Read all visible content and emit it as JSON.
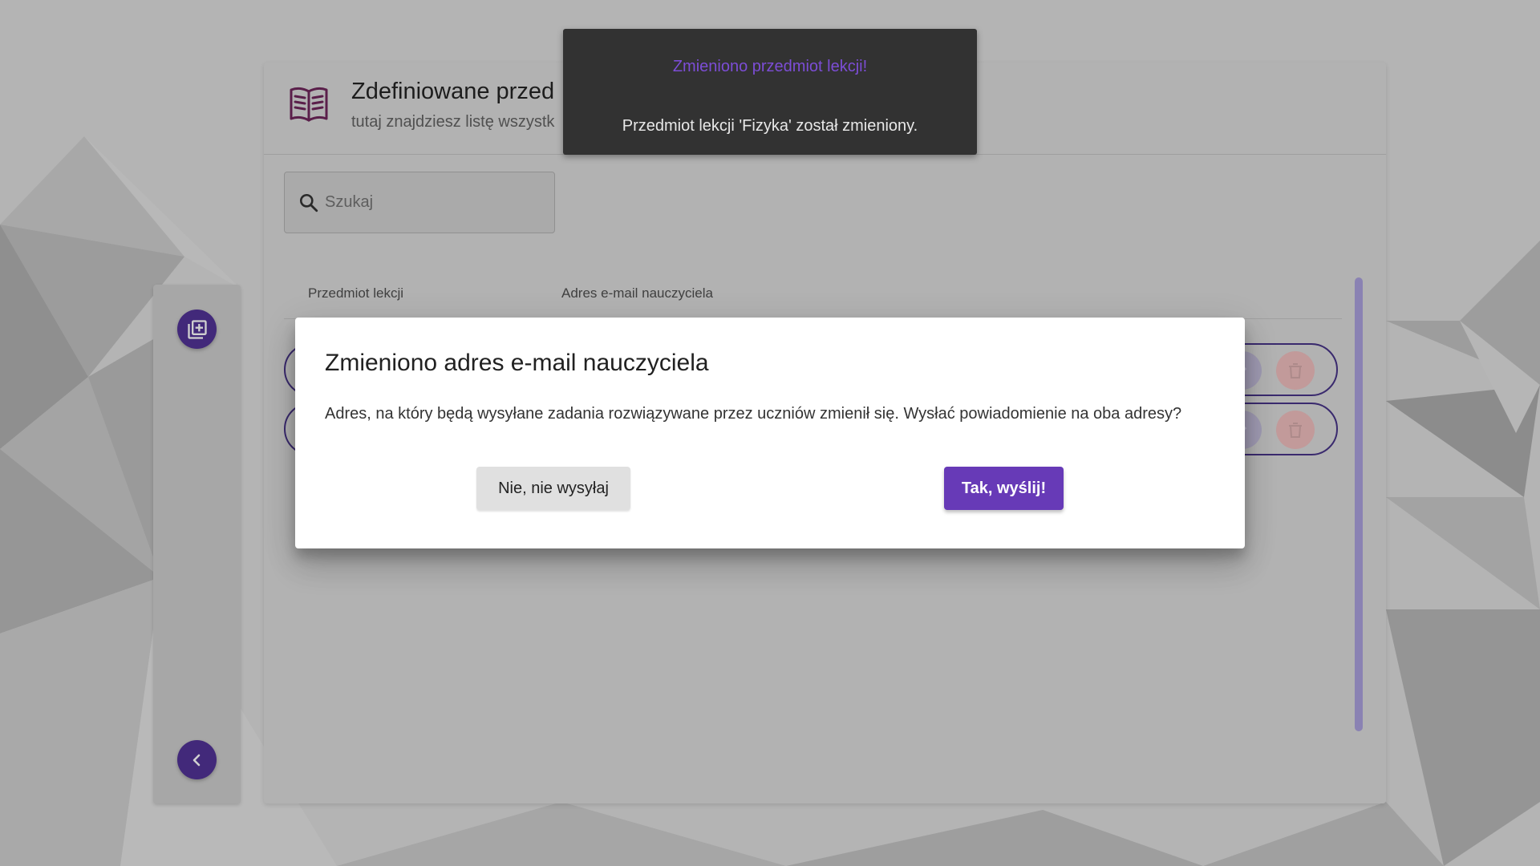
{
  "colors": {
    "accent": "#673ab7",
    "toast_title": "#7c4dd6",
    "toast_bg": "#323232",
    "delete": "#e57373"
  },
  "header": {
    "title": "Zdefiniowane przed",
    "subtitle": "tutaj znajdziesz listę wszystk"
  },
  "search": {
    "placeholder": "Szukaj"
  },
  "table": {
    "columns": [
      "Przedmiot lekcji",
      "Adres e-mail nauczyciela"
    ]
  },
  "sidebar": {
    "icons": {
      "add": "library-add-icon",
      "collapse": "chevron-left-icon"
    }
  },
  "toast": {
    "title": "Zmieniono przedmiot lekcji!",
    "message": "Przedmiot lekcji 'Fizyka' został zmieniony."
  },
  "dialog": {
    "title": "Zmieniono adres e-mail nauczyciela",
    "body": "Adres, na który będą wysyłane zadania rozwiązywane przez uczniów zmienił się. Wysłać powiadomienie na oba adresy?",
    "cancel_label": "Nie, nie wysyłaj",
    "confirm_label": "Tak, wyślij!"
  }
}
